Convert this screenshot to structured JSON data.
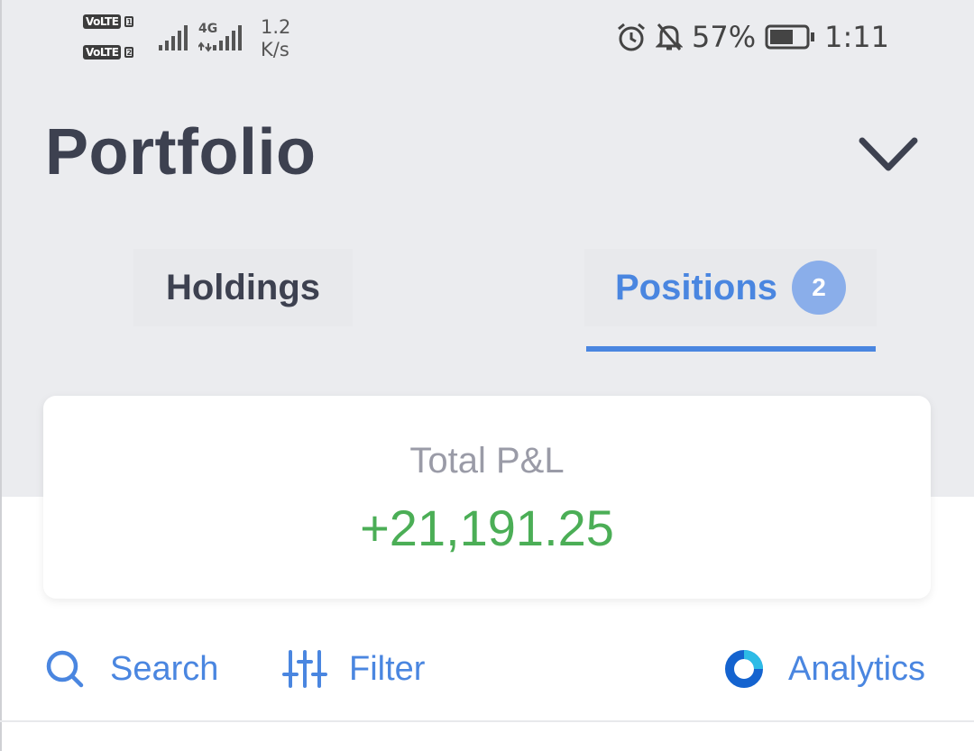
{
  "status_bar": {
    "volte_1": "VoLTE",
    "sim_1": "1",
    "volte_2": "VoLTE",
    "sim_2": "2",
    "network_type": "4G",
    "speed_value": "1.2",
    "speed_unit": "K/s",
    "battery_percent": "57%",
    "time": "1:11"
  },
  "header": {
    "title": "Portfolio"
  },
  "tabs": [
    {
      "label": "Holdings",
      "active": false
    },
    {
      "label": "Positions",
      "active": true,
      "badge": "2"
    }
  ],
  "summary": {
    "label": "Total P&L",
    "value": "+21,191.25"
  },
  "actions": {
    "search": "Search",
    "filter": "Filter",
    "analytics": "Analytics"
  },
  "colors": {
    "accent": "#4a86e0",
    "profit": "#4bae56",
    "title": "#3d4150",
    "header_bg": "#ebecef"
  },
  "icons": [
    "chevron-down-icon",
    "search-icon",
    "filter-sliders-icon",
    "analytics-donut-icon",
    "alarm-icon",
    "bell-off-icon",
    "battery-icon",
    "signal-icon"
  ]
}
